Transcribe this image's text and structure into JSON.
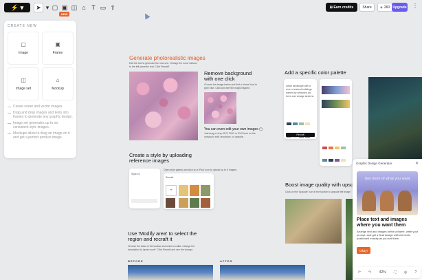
{
  "toolbar": {
    "logo": "⚡",
    "new_badge": "NEW",
    "earn_credits": "Earn credits",
    "share": "Share",
    "credits": "260",
    "upgrade": "Upgrade",
    "more": "⋮"
  },
  "sidebar": {
    "heading": "CREATE NEW",
    "tiles": [
      {
        "label": "Image",
        "icon": "image-icon"
      },
      {
        "label": "Frame",
        "icon": "frame-icon"
      },
      {
        "label": "Image set",
        "icon": "image-set-icon"
      },
      {
        "label": "Mockup",
        "icon": "shirt-icon"
      }
    ],
    "hints": [
      "Create raster and vector images.",
      "Drag and drop images and texts into frames to generate any graphic design.",
      "Image set generates up to six consistent style images.",
      "Mockups allow to drag an image on it and get a perfect product image."
    ]
  },
  "canvas": {
    "photo_title": "Generate photorealistic images",
    "photo_desc": "Edit the text to generate the new one. Change the word 'sakura' to the left-powerful real. Click Recraft!",
    "remove_title": "Remove background with one click",
    "remove_desc": "Choose the image below and find a shovel icon to grey blue. Click and see the magic happen.",
    "remove_own": "You can even edit your own images",
    "remove_own_desc": "Just drag or drop JPG, PNG or SVG here on the canvas to edit, recolorize, or upscale.",
    "palette_title": "Add a specific color palette",
    "style_title": "Create a style by uploading reference images",
    "style_desc": "Open style gallery and click on a 'Plus' icon to upload up to 5 images.",
    "upscale_title": "Boost image quality with upsca",
    "upscale_desc": "Click on the 'Upscale' icon in the toolbar to upscale the image",
    "modify_title": "Use 'Modify area' to select the region  and recraft it",
    "modify_desc": "Choose the lasso in the toolbar and select a collar. Change the description to 'green scarf'. Click Recraft and see the change.",
    "before": "BEFORE",
    "after": "AFTER",
    "palette_card": {
      "desc": "urban landscape with a river of ancient buildings framed by centuries old trees and vintage lanterns",
      "recraft": "Recraft"
    },
    "style_card": {
      "name": "Style #1",
      "label": "Recraft",
      "note": "Just drag or drop"
    }
  },
  "palette_colors": [
    "#2c3e5c",
    "#e07b39",
    "#f3c56a",
    "#5a8a9b",
    "#c94f4f",
    "#7a5c8e",
    "#9fc0a5",
    "#f0e2b6"
  ],
  "panel": {
    "title": "Graphic Design Generator",
    "banner": "Get more of what you want",
    "heading": "Place text and images where you want them",
    "body": "Arrange text and images within a frame, write your prompt, and get a final design with elements positioned exactly as you set them",
    "okay": "Okay!"
  },
  "zoom": {
    "value": "42%"
  }
}
